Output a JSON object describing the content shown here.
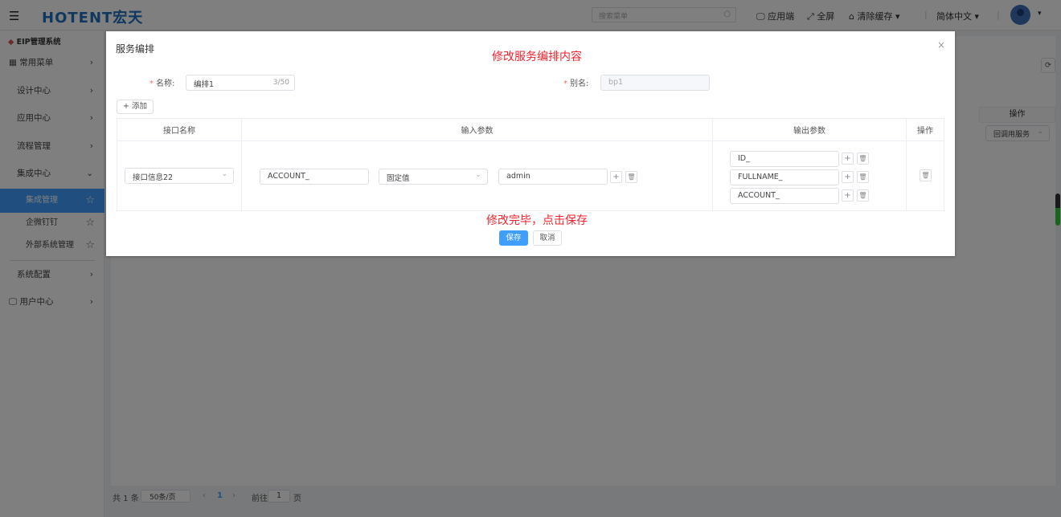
{
  "header": {
    "logo": "HOTENT宏天",
    "search_placeholder": "搜索菜单",
    "app_end": "应用端",
    "fullscreen": "全屏",
    "clear_cache": "清除缓存",
    "language": "简体中文"
  },
  "sidebar": {
    "system": "EIP管理系统",
    "items": [
      {
        "label": "常用菜单"
      },
      {
        "label": "设计中心"
      },
      {
        "label": "应用中心"
      },
      {
        "label": "流程管理"
      },
      {
        "label": "集成中心"
      },
      {
        "label": "集成管理"
      },
      {
        "label": "企微钉钉"
      },
      {
        "label": "外部系统管理"
      },
      {
        "label": "系统配置"
      },
      {
        "label": "用户中心"
      }
    ]
  },
  "background": {
    "ops_header": "操作",
    "callback_select": "回调用服务",
    "pagination": {
      "total": "共 1 条",
      "page_size": "50条/页",
      "current": "1",
      "goto": "前往",
      "goto_value": "1",
      "page_unit": "页"
    }
  },
  "dialog": {
    "title": "服务编排",
    "annotation_top": "修改服务编排内容",
    "annotation_bottom": "修改完毕，点击保存",
    "name_label": "名称:",
    "name_value": "编排1",
    "name_count": "3/50",
    "alias_label": "别名:",
    "alias_value": "bp1",
    "add_button": "添加",
    "columns": [
      "接口名称",
      "输入参数",
      "输出参数",
      "操作"
    ],
    "row": {
      "interface": "接口信息22",
      "input": {
        "field": "ACCOUNT_",
        "type": "固定值",
        "value": "admin"
      },
      "outputs": [
        "ID_",
        "FULLNAME_",
        "ACCOUNT_"
      ]
    },
    "save": "保存",
    "cancel": "取消"
  }
}
